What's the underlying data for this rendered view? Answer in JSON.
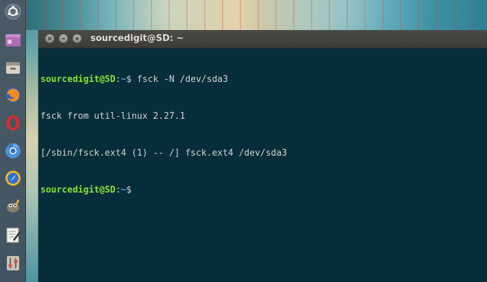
{
  "launcher": {
    "items": [
      {
        "name": "dash-home-icon"
      },
      {
        "name": "app-icon"
      },
      {
        "name": "files-icon"
      },
      {
        "name": "firefox-icon"
      },
      {
        "name": "opera-icon"
      },
      {
        "name": "chromium-icon"
      },
      {
        "name": "safari-like-browser-icon"
      },
      {
        "name": "gimp-icon"
      },
      {
        "name": "text-editor-icon"
      },
      {
        "name": "settings-icon"
      }
    ]
  },
  "window": {
    "title": "sourcedigit@SD: ~"
  },
  "terminal": {
    "lines": [
      {
        "type": "prompt",
        "user": "sourcedigit@SD",
        "colon": ":",
        "path": "~",
        "dollar": "$",
        "command": " fsck -N /dev/sda3"
      },
      {
        "type": "output",
        "text": "fsck from util-linux 2.27.1"
      },
      {
        "type": "output",
        "text": "[/sbin/fsck.ext4 (1) -- /] fsck.ext4 /dev/sda3"
      },
      {
        "type": "prompt",
        "user": "sourcedigit@SD",
        "colon": ":",
        "path": "~",
        "dollar": "$",
        "command": ""
      }
    ]
  },
  "colors": {
    "terminal_bg": "#062e3a",
    "prompt_user": "#8ae234",
    "prompt_path": "#729fcf",
    "text": "#d2d2d2",
    "titlebar": "#3c3b37",
    "launcher": "#4a5b67"
  }
}
